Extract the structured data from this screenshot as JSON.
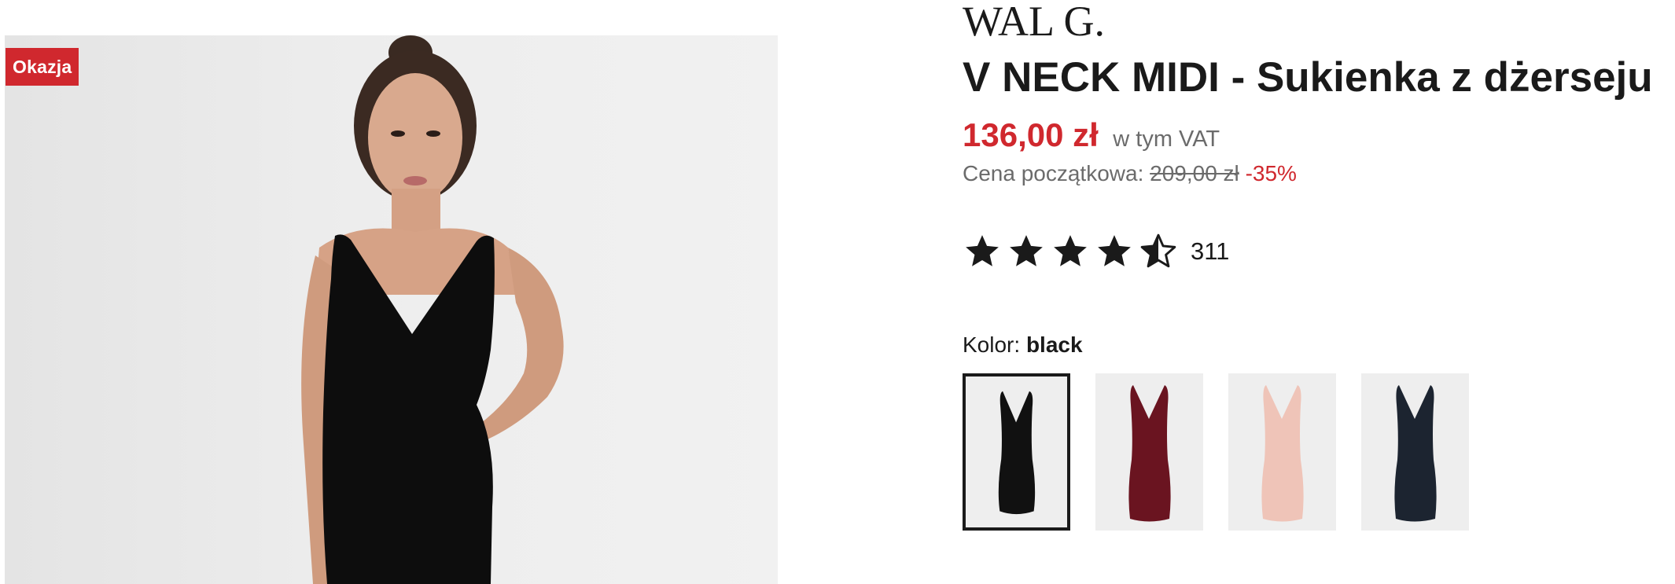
{
  "badge": {
    "label": "Okazja",
    "color": "#d0282e"
  },
  "product": {
    "brand": "WAL G.",
    "title": "V NECK MIDI - Sukienka z dżerseju"
  },
  "pricing": {
    "price": "136,00 zł",
    "vat_note": "w tym VAT",
    "original_label": "Cena początkowa:",
    "original_price": "209,00 zł",
    "discount": "-35%",
    "accent_color": "#d0282e"
  },
  "rating": {
    "value": 4.5,
    "max": 5,
    "count": "311"
  },
  "color": {
    "label": "Kolor:",
    "selected": "black",
    "options": [
      {
        "name": "black",
        "hex": "#111111",
        "selected": true
      },
      {
        "name": "burgundy",
        "hex": "#6a1420",
        "selected": false
      },
      {
        "name": "nude pink",
        "hex": "#efc4b8",
        "selected": false
      },
      {
        "name": "navy",
        "hex": "#1c2430",
        "selected": false
      }
    ]
  },
  "icons": {
    "star": "star-icon",
    "half_star": "half-star-icon"
  }
}
